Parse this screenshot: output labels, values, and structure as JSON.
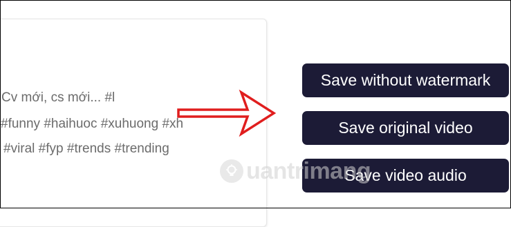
{
  "caption": {
    "line1": "Cv mới, cs mới... #l",
    "line2": "#funny #haihuoc #xuhuong #xh",
    "line3": "#viral #fyp #trends #trending"
  },
  "buttons": {
    "save_without_watermark": "Save without watermark",
    "save_original_video": "Save original video",
    "save_video_audio": "Save video audio"
  },
  "watermark": {
    "text": "uantrimang",
    "logo": "lightbulb-logo"
  },
  "colors": {
    "button_bg": "#1c1b36",
    "button_text": "#ffffff",
    "arrow": "#e01e1e",
    "caption_text": "#6b6b6b"
  },
  "icons": {
    "arrow": "red-outline-arrow-right"
  }
}
